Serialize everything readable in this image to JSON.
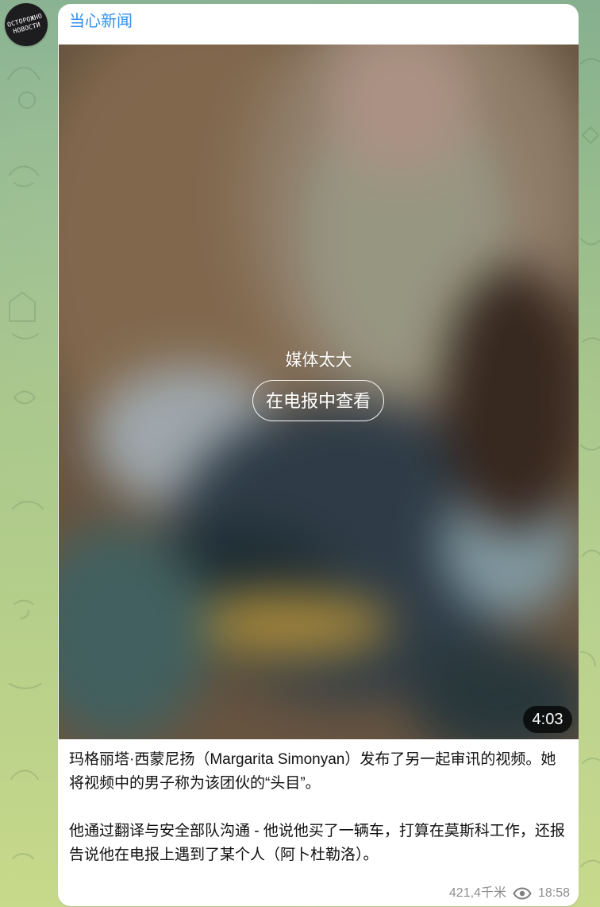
{
  "channel": {
    "name": "当心新闻",
    "avatar_text": "ОСТОРОЖНО\nНОВОСТИ"
  },
  "media": {
    "notice": "媒体太大",
    "button_label": "在电报中查看",
    "duration": "4:03"
  },
  "post": {
    "paragraph_1": "玛格丽塔·西蒙尼扬（Margarita Simonyan）发布了另一起审讯的视频。她将视频中的男子称为该团伙的“头目”。",
    "paragraph_2": "他通过翻译与安全部队沟通 - 他说他买了一辆车，打算在莫斯科工作，还报告说他在电报上遇到了某个人（阿卜杜勒洛）。"
  },
  "meta": {
    "views": "421,4千米",
    "time": "18:58"
  },
  "icons": {
    "eye": "eye-icon"
  },
  "colors": {
    "accent": "#3390ec"
  }
}
